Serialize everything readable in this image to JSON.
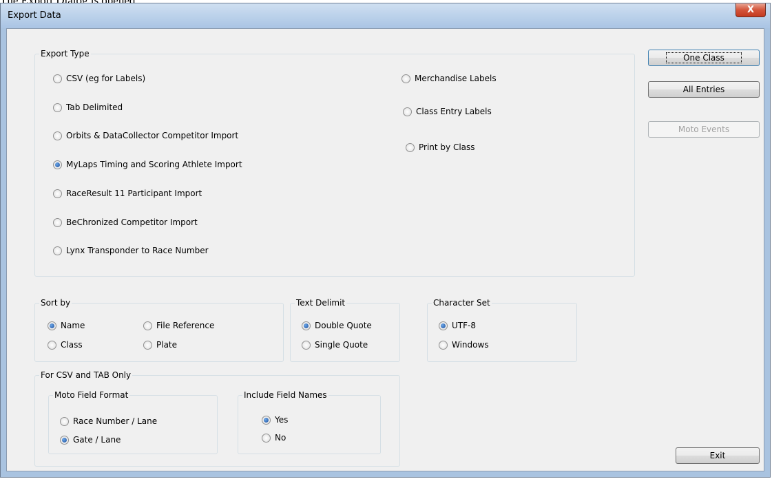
{
  "caption": "The Export Dialog is opened.",
  "window": {
    "title": "Export Data",
    "close_label": "X"
  },
  "export_type": {
    "legend": "Export Type",
    "options": [
      {
        "label": "CSV (eg for Labels)",
        "selected": false
      },
      {
        "label": "Tab Delimited",
        "selected": false
      },
      {
        "label": "Orbits & DataCollector Competitor Import",
        "selected": false
      },
      {
        "label": "MyLaps Timing and Scoring Athlete Import",
        "selected": true
      },
      {
        "label": "RaceResult 11 Participant Import",
        "selected": false
      },
      {
        "label": "BeChronized Competitor Import",
        "selected": false
      },
      {
        "label": "Lynx Transponder to Race Number",
        "selected": false
      },
      {
        "label": "Merchandise Labels",
        "selected": false
      },
      {
        "label": "Class Entry Labels",
        "selected": false
      },
      {
        "label": "Print by Class",
        "selected": false
      }
    ]
  },
  "buttons": {
    "one_class": "One Class",
    "all_entries": "All Entries",
    "moto_events": "Moto Events",
    "exit": "Exit"
  },
  "sort_by": {
    "legend": "Sort by",
    "options": [
      {
        "label": "Name",
        "selected": true
      },
      {
        "label": "File Reference",
        "selected": false
      },
      {
        "label": "Class",
        "selected": false
      },
      {
        "label": "Plate",
        "selected": false
      }
    ]
  },
  "text_delimit": {
    "legend": "Text Delimit",
    "options": [
      {
        "label": "Double Quote",
        "selected": true
      },
      {
        "label": "Single Quote",
        "selected": false
      }
    ]
  },
  "character_set": {
    "legend": "Character Set",
    "options": [
      {
        "label": "UTF-8",
        "selected": true
      },
      {
        "label": "Windows",
        "selected": false
      }
    ]
  },
  "csv_tab": {
    "legend": "For CSV and TAB Only",
    "moto_field_format": {
      "legend": "Moto Field Format",
      "options": [
        {
          "label": "Race Number / Lane",
          "selected": false
        },
        {
          "label": "Gate / Lane",
          "selected": true
        }
      ]
    },
    "include_field_names": {
      "legend": "Include Field Names",
      "options": [
        {
          "label": "Yes",
          "selected": true
        },
        {
          "label": "No",
          "selected": false
        }
      ]
    }
  }
}
